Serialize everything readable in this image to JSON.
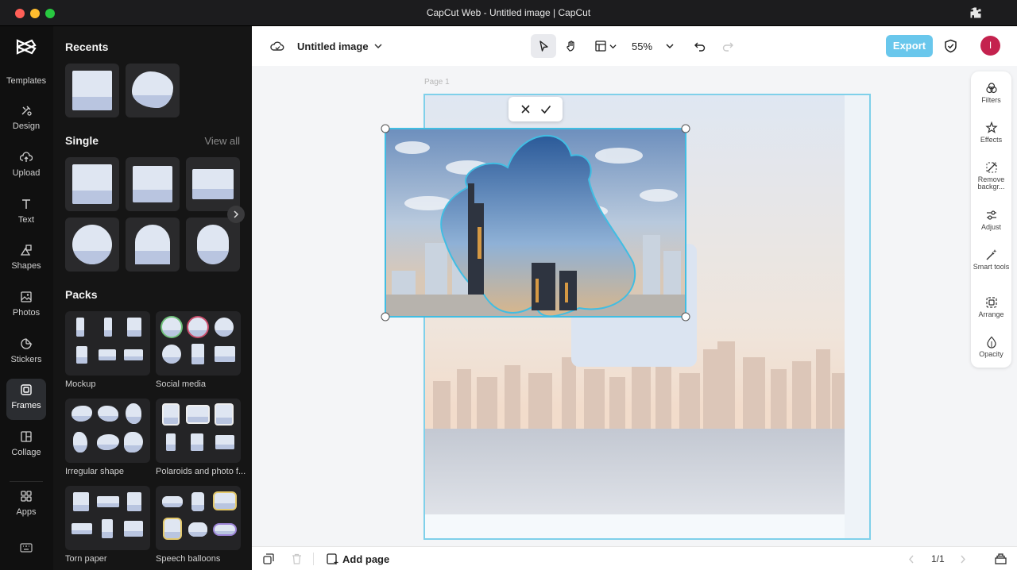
{
  "window": {
    "title": "CapCut Web - Untitled image | CapCut"
  },
  "rail": {
    "items": [
      {
        "label": "Templates",
        "icon": "capcut-logo-icon"
      },
      {
        "label": "Design",
        "icon": "design-icon"
      },
      {
        "label": "Upload",
        "icon": "upload-icon"
      },
      {
        "label": "Text",
        "icon": "text-icon"
      },
      {
        "label": "Shapes",
        "icon": "shapes-icon"
      },
      {
        "label": "Photos",
        "icon": "photos-icon"
      },
      {
        "label": "Stickers",
        "icon": "stickers-icon"
      },
      {
        "label": "Frames",
        "icon": "frames-icon",
        "active": true
      },
      {
        "label": "Collage",
        "icon": "collage-icon"
      },
      {
        "label": "Apps",
        "icon": "apps-icon"
      }
    ]
  },
  "panel": {
    "recents_title": "Recents",
    "single_title": "Single",
    "view_all": "View all",
    "packs_title": "Packs",
    "packs": [
      {
        "label": "Mockup"
      },
      {
        "label": "Social media"
      },
      {
        "label": "Irregular shape"
      },
      {
        "label": "Polaroids and photo f..."
      },
      {
        "label": "Torn paper"
      },
      {
        "label": "Speech balloons"
      }
    ]
  },
  "topbar": {
    "doc_title": "Untitled image",
    "zoom": "55%",
    "export_label": "Export",
    "avatar_initial": "I"
  },
  "canvas": {
    "page_label": "Page 1"
  },
  "right_tools": {
    "items": [
      {
        "label": "Filters",
        "icon": "filters-icon"
      },
      {
        "label": "Effects",
        "icon": "effects-icon"
      },
      {
        "label": "Remove backgr...",
        "icon": "remove-background-icon"
      },
      {
        "label": "Adjust",
        "icon": "adjust-icon"
      },
      {
        "label": "Smart tools",
        "icon": "smart-tools-icon"
      },
      {
        "label": "Arrange",
        "icon": "arrange-icon"
      },
      {
        "label": "Opacity",
        "icon": "opacity-icon"
      }
    ]
  },
  "bottombar": {
    "add_page": "Add page",
    "page_count": "1/1"
  },
  "colors": {
    "accent": "#69c7ec",
    "selection": "#3cc0e0",
    "avatar": "#c4224e",
    "rail_bg": "#101010",
    "panel_bg": "#151515"
  }
}
